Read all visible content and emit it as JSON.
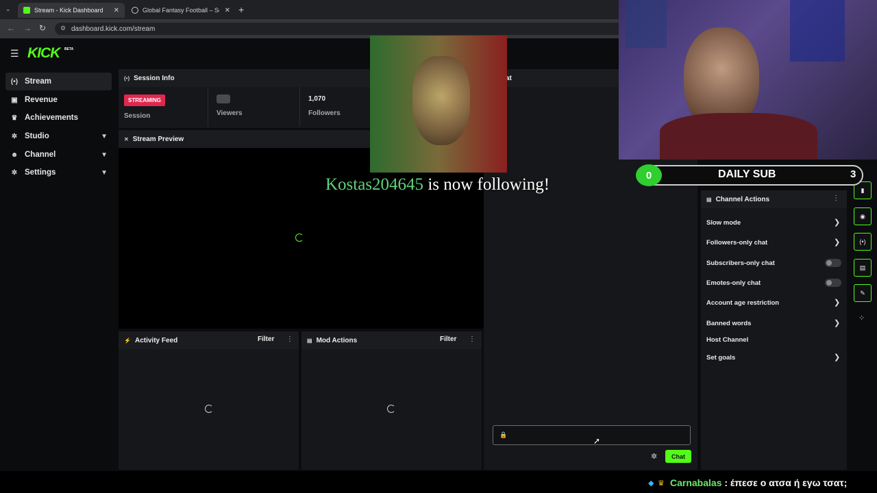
{
  "browser": {
    "tabs": [
      {
        "title": "Stream - Kick Dashboard"
      },
      {
        "title": "Global Fantasy Football – Soran"
      }
    ],
    "url": "dashboard.kick.com/stream"
  },
  "brand": {
    "logo": "KICK",
    "beta": "BETA",
    "accent": "#53fc18"
  },
  "sidebar": {
    "items": [
      {
        "label": "Stream",
        "icon": "broadcast-icon"
      },
      {
        "label": "Revenue",
        "icon": "chart-icon"
      },
      {
        "label": "Achievements",
        "icon": "trophy-icon"
      },
      {
        "label": "Studio",
        "icon": "gear-icon"
      },
      {
        "label": "Channel",
        "icon": "people-icon"
      },
      {
        "label": "Settings",
        "icon": "gear-icon"
      }
    ]
  },
  "session": {
    "title": "Session Info",
    "status": "STREAMING",
    "session_label": "Session",
    "viewers_label": "Viewers",
    "followers_value": "1,070",
    "followers_label": "Followers"
  },
  "preview": {
    "title": "Stream Preview"
  },
  "chat": {
    "title_fragment": "at",
    "send_label": "Chat"
  },
  "activity": {
    "title": "Activity Feed",
    "filter": "Filter"
  },
  "mod": {
    "title": "Mod Actions",
    "filter": "Filter"
  },
  "overlay": {
    "follower_name": "Kostas204645",
    "follow_text": "is now following!",
    "daily_sub_current": "0",
    "daily_sub_label": "DAILY SUB",
    "daily_sub_goal": "3",
    "chat_user": "Carnabalas",
    "chat_message": ": έπεσε ο ατσα ή εγω τσατ;"
  },
  "channel_actions": {
    "title": "Channel Actions",
    "items": [
      {
        "label": "Slow mode",
        "control": "chevron"
      },
      {
        "label": "Followers-only chat",
        "control": "chevron"
      },
      {
        "label": "Subscribers-only chat",
        "control": "toggle"
      },
      {
        "label": "Emotes-only chat",
        "control": "toggle"
      },
      {
        "label": "Account age restriction",
        "control": "chevron"
      },
      {
        "label": "Banned words",
        "control": "chevron"
      },
      {
        "label": "Host Channel",
        "control": "none"
      },
      {
        "label": "Set goals",
        "control": "chevron"
      }
    ]
  }
}
